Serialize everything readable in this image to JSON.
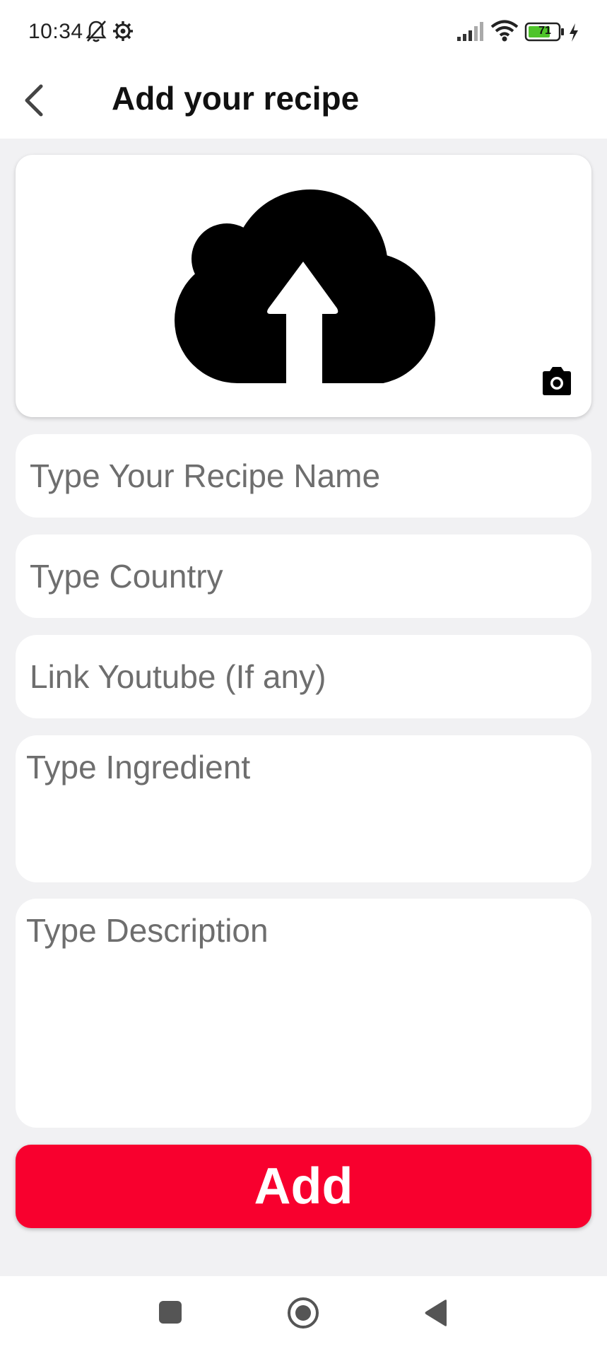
{
  "status_bar": {
    "time": "10:34",
    "battery_level": "71",
    "icons": [
      "bell-off-icon",
      "settings-gear-icon",
      "signal-icon",
      "wifi-icon",
      "battery-icon",
      "charging-icon"
    ]
  },
  "header": {
    "title": "Add your recipe",
    "back_icon": "chevron-left-icon"
  },
  "upload": {
    "icon": "cloud-upload-icon",
    "camera_icon": "camera-icon"
  },
  "form": {
    "recipe_name_placeholder": "Type Your Recipe Name",
    "country_placeholder": "Type Country",
    "youtube_placeholder": "Link Youtube (If any)",
    "ingredient_placeholder": "Type Ingredient",
    "description_placeholder": "Type Description"
  },
  "add_button": {
    "label": "Add"
  },
  "colors": {
    "accent": "#f8002e",
    "background": "#f1f1f3",
    "battery_fill": "#4fc42a"
  },
  "nav_bar": {
    "icons": [
      "recents-square-icon",
      "home-circle-icon",
      "back-triangle-icon"
    ]
  }
}
